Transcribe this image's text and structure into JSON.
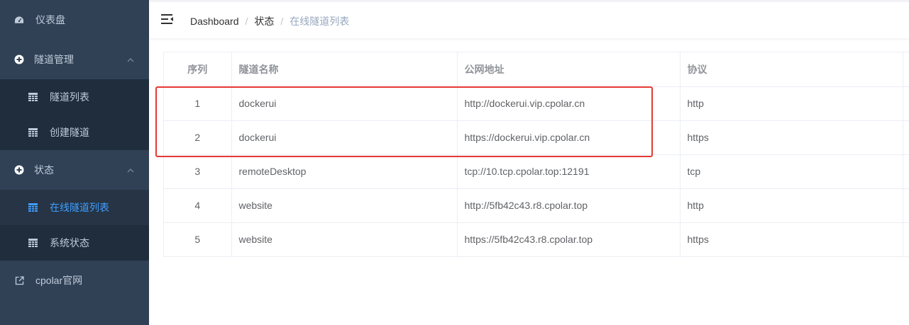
{
  "sidebar": {
    "dashboard": {
      "label": "仪表盘",
      "icon": "dashboard-gauge-icon"
    },
    "tunnel_mgmt": {
      "label": "隧道管理",
      "icon": "circle-plus-icon",
      "items": [
        {
          "label": "隧道列表",
          "icon": "table-icon"
        },
        {
          "label": "创建隧道",
          "icon": "table-icon"
        }
      ]
    },
    "status": {
      "label": "状态",
      "icon": "circle-plus-icon",
      "items": [
        {
          "label": "在线隧道列表",
          "icon": "table-icon",
          "active": true
        },
        {
          "label": "系统状态",
          "icon": "table-icon"
        }
      ]
    },
    "official": {
      "label": "cpolar官网",
      "icon": "external-link-icon"
    }
  },
  "colors": {
    "sidebar_bg": "#304156",
    "submenu_bg": "#1f2d3d",
    "active_item_bg": "#263445",
    "accent": "#409eff",
    "highlight_box": "#e53935"
  },
  "navbar": {
    "breadcrumb": [
      "Dashboard",
      "状态",
      "在线隧道列表"
    ],
    "separator": "/"
  },
  "table": {
    "columns": [
      "序列",
      "隧道名称",
      "公网地址",
      "协议"
    ],
    "rows": [
      {
        "index": "1",
        "name": "dockerui",
        "address": "http://dockerui.vip.cpolar.cn",
        "protocol": "http"
      },
      {
        "index": "2",
        "name": "dockerui",
        "address": "https://dockerui.vip.cpolar.cn",
        "protocol": "https"
      },
      {
        "index": "3",
        "name": "remoteDesktop",
        "address": "tcp://10.tcp.cpolar.top:12191",
        "protocol": "tcp"
      },
      {
        "index": "4",
        "name": "website",
        "address": "http://5fb42c43.r8.cpolar.top",
        "protocol": "http"
      },
      {
        "index": "5",
        "name": "website",
        "address": "https://5fb42c43.r8.cpolar.top",
        "protocol": "https"
      }
    ]
  }
}
